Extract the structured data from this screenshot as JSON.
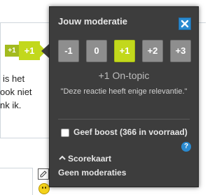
{
  "background": {
    "score_small": "+1",
    "score_big": "+1",
    "text_lines": [
      "is het",
      "ook niet",
      "nk ik."
    ]
  },
  "popup": {
    "title": "Jouw moderatie",
    "votes": [
      {
        "label": "-1",
        "selected": false
      },
      {
        "label": "0",
        "selected": false
      },
      {
        "label": "+1",
        "selected": true
      },
      {
        "label": "+2",
        "selected": false
      },
      {
        "label": "+3",
        "selected": false
      }
    ],
    "selected_vote_label": "+1 On-topic",
    "selected_vote_description": "\"Deze reactie heeft enige relevantie.\"",
    "boost": {
      "label": "Geef boost (366 in voorraad)",
      "checked": false
    },
    "help_label": "?",
    "scorecard_label": "Scorekaart",
    "no_moderations_label": "Geen moderaties"
  },
  "colors": {
    "popup_bg": "#3d3d3d",
    "vote_button": "#8e8e8e",
    "vote_selected": "#c2d81c",
    "accent_blue": "#2a8ad0"
  },
  "icons": {
    "close": "close-icon",
    "help": "help-icon",
    "scorecard_toggle": "chevron-up-icon",
    "edit": "edit-icon",
    "smiley": "smiley-icon"
  }
}
